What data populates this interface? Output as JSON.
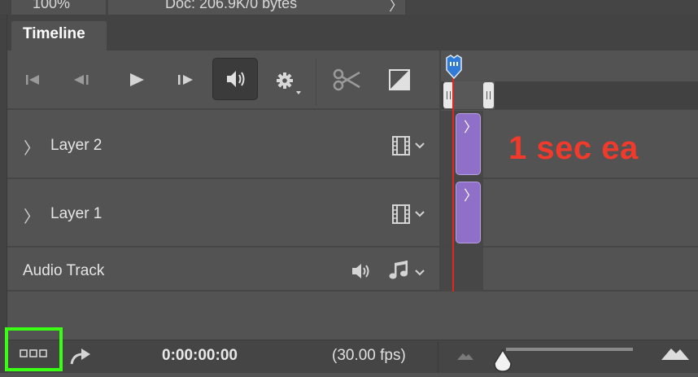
{
  "status_bar": {
    "zoom": "100%",
    "doc_info": "Doc: 206.9K/0 bytes",
    "arrow": "〉"
  },
  "panel": {
    "tab_label": "Timeline"
  },
  "controls": {
    "first_frame_icon": "skip-to-first-frame-icon",
    "prev_frame_icon": "previous-frame-icon",
    "play_icon": "play-icon",
    "next_frame_icon": "next-frame-icon",
    "audio_icon": "speaker-icon",
    "settings_icon": "gear-icon",
    "split_icon": "scissors-icon",
    "transition_icon": "transition-icon"
  },
  "tracks": [
    {
      "label": "Layer 2",
      "expand_glyph": "〉",
      "type_icon": "film-icon",
      "dropdown_icon": "chevron-down-icon",
      "clip_glyph": "〉"
    },
    {
      "label": "Layer 1",
      "expand_glyph": "〉",
      "type_icon": "film-icon",
      "dropdown_icon": "chevron-down-icon",
      "clip_glyph": "〉"
    },
    {
      "label": "Audio Track",
      "mute_icon": "speaker-icon",
      "type_icon": "music-note-icon",
      "dropdown_icon": "chevron-down-icon"
    }
  ],
  "annotation": "1 sec ea",
  "footer": {
    "time": "0:00:00:00",
    "fps": "(30.00 fps)",
    "frames_icon": "convert-to-frame-animation-icon",
    "convert_icon": "render-video-arrow-icon",
    "zoom_out_icon": "small-mountain-icon",
    "zoom_in_icon": "large-mountain-icon"
  },
  "colors": {
    "panel": "#535353",
    "clip": "#8f6fc7",
    "playhead": "#e0271d",
    "annotation": "#f03a2c",
    "highlight": "#39ff14",
    "playhead_marker": "#2f7bd6"
  }
}
